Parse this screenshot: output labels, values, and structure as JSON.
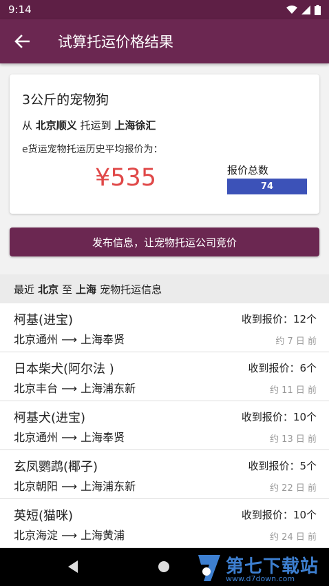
{
  "status": {
    "time": "9:14"
  },
  "appbar": {
    "title": "试算托运价格结果"
  },
  "card": {
    "pet": "3公斤的宠物狗",
    "from_prefix": "从",
    "from": "北京顺义",
    "mid": "托运到",
    "to": "上海徐汇",
    "avg_label": "e货运宠物托运历史平均报价为：",
    "price": "¥535",
    "quote_label": "报价总数",
    "quote_count": "74"
  },
  "publish_button": "发布信息，让宠物托运公司竞价",
  "section": {
    "prefix": "最近",
    "from": "北京",
    "mid": "至",
    "to": "上海",
    "suffix": "宠物托运信息"
  },
  "rows": [
    {
      "name": "柯基(进宝)",
      "route": "北京通州 ⟶ 上海奉贤",
      "quotes": "收到报价：12个",
      "time": "约 7 日 前"
    },
    {
      "name": "日本柴犬(阿尔法 )",
      "route": "北京丰台 ⟶ 上海浦东新",
      "quotes": "收到报价：6个",
      "time": "约 11 日 前"
    },
    {
      "name": "柯基犬(进宝)",
      "route": "北京通州 ⟶ 上海奉贤",
      "quotes": "收到报价：10个",
      "time": "约 13 日 前"
    },
    {
      "name": "玄凤鹦鹉(椰子)",
      "route": "北京朝阳 ⟶ 上海浦东新",
      "quotes": "收到报价：5个",
      "time": "约 22 日 前"
    },
    {
      "name": "英短(猫咪)",
      "route": "北京海淀 ⟶ 上海黄浦",
      "quotes": "收到报价：10个",
      "time": "约 24 日 前"
    }
  ],
  "watermark": {
    "text": "第七下载站",
    "sub": "www.d7down.com"
  },
  "colors": {
    "appbar": "#6b2751",
    "price": "#e04848",
    "quote_bar": "#3c52b8"
  }
}
